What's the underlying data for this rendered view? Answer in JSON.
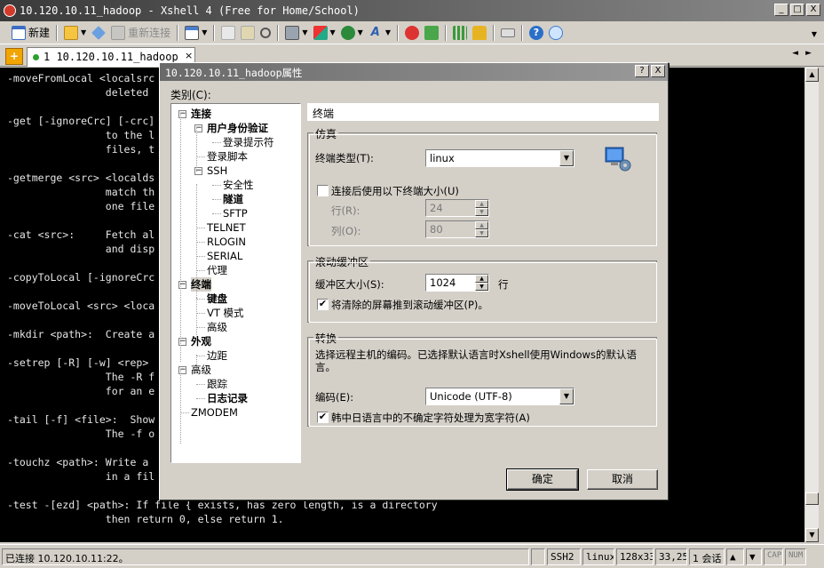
{
  "window": {
    "title": "10.120.10.11_hadoop - Xshell 4 (Free for Home/School)",
    "min": "_",
    "max": "□",
    "close": "X"
  },
  "toolbar": {
    "new_label": "新建",
    "reconnect_label": "重新连接"
  },
  "tabs": {
    "active": "1 10.120.10.11_hadoop",
    "close": "×",
    "arrows": "◄►"
  },
  "terminal": {
    "lines": [
      "-moveFromLocal <localsrc",
      "                deleted ",
      "",
      "-get [-ignoreCrc] [-crc]",
      "                to the l",
      "                files, t",
      "",
      "-getmerge <src> <localds",
      "                match th",
      "                one file",
      "",
      "-cat <src>:     Fetch al",
      "                and disp",
      "",
      "-copyToLocal [-ignoreCrc",
      "",
      "-moveToLocal <src> <loca",
      "",
      "-mkdir <path>:  Create a",
      "",
      "-setrep [-R] [-w] <rep> ",
      "                The -R f",
      "                for an e",
      "",
      "-tail [-f] <file>:  Show",
      "                The -f o",
      "",
      "-touchz <path>: Write a ",
      "                in a fil",
      "",
      "-test -[ezd] <path>: If file { exists, has zero length, is a directory",
      "                then return 0, else return 1."
    ]
  },
  "statusbar": {
    "connection": "已连接 10.120.10.11:22。",
    "protocol": "SSH2",
    "term": "linux",
    "size": "128x33",
    "cursor": "33,25",
    "sessions": "1 会话",
    "cap": "CAP",
    "num": "NUM"
  },
  "dialog": {
    "title": "10.120.10.11_hadoop属性",
    "help": "?",
    "close": "X",
    "category_label": "类别(C):",
    "tree": [
      {
        "label": "连接",
        "bold": true,
        "expander": "−"
      },
      {
        "label": "用户身份验证",
        "bold": true,
        "expander": "−"
      },
      {
        "label": "登录提示符",
        "bold": false
      },
      {
        "label": "登录脚本",
        "bold": false
      },
      {
        "label": "SSH",
        "bold": false,
        "expander": "−"
      },
      {
        "label": "安全性",
        "bold": false
      },
      {
        "label": "隧道",
        "bold": true
      },
      {
        "label": "SFTP",
        "bold": false
      },
      {
        "label": "TELNET",
        "bold": false
      },
      {
        "label": "RLOGIN",
        "bold": false
      },
      {
        "label": "SERIAL",
        "bold": false
      },
      {
        "label": "代理",
        "bold": false
      },
      {
        "label": "终端",
        "bold": true,
        "expander": "−",
        "selected": true
      },
      {
        "label": "键盘",
        "bold": true
      },
      {
        "label": "VT 模式",
        "bold": false
      },
      {
        "label": "高级",
        "bold": false
      },
      {
        "label": "外观",
        "bold": true,
        "expander": "−"
      },
      {
        "label": "边距",
        "bold": false
      },
      {
        "label": "高级",
        "bold": false,
        "expander": "−"
      },
      {
        "label": "跟踪",
        "bold": false
      },
      {
        "label": "日志记录",
        "bold": true
      },
      {
        "label": "ZMODEM",
        "bold": false
      }
    ],
    "page_title": "终端",
    "emulation": {
      "group_title": "仿真",
      "terminal_type_label": "终端类型(T):",
      "terminal_type_value": "linux",
      "custom_size_label": "连接后使用以下终端大小(U)",
      "custom_size_checked": false,
      "rows_label": "行(R):",
      "rows_value": "24",
      "cols_label": "列(O):",
      "cols_value": "80"
    },
    "scrollback": {
      "group_title": "滚动缓冲区",
      "size_label": "缓冲区大小(S):",
      "size_value": "1024",
      "size_unit": "行",
      "push_label": "将清除的屏幕推到滚动缓冲区(P)。",
      "push_checked": true
    },
    "translation": {
      "group_title": "转换",
      "desc": "选择远程主机的编码。已选择默认语言时Xshell使用Windows的默认语言。",
      "encoding_label": "编码(E):",
      "encoding_value": "Unicode (UTF-8)",
      "cjk_label": "韩中日语言中的不确定字符处理为宽字符(A)",
      "cjk_checked": true
    },
    "ok_label": "确定",
    "cancel_label": "取消"
  }
}
